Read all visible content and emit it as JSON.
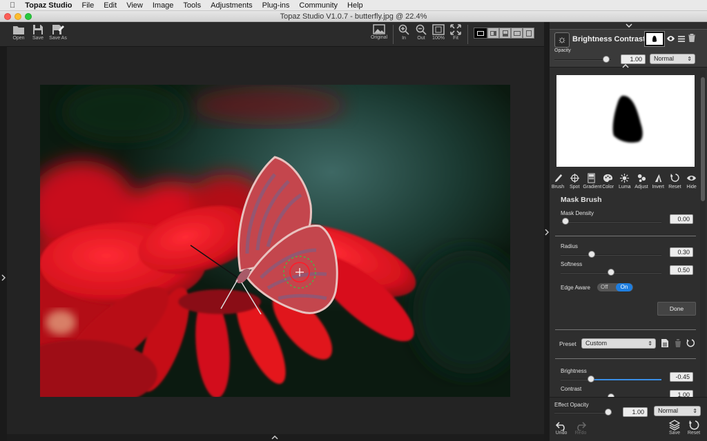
{
  "menubar": {
    "app": "Topaz Studio",
    "items": [
      "File",
      "Edit",
      "View",
      "Image",
      "Tools",
      "Adjustments",
      "Plug-ins",
      "Community",
      "Help"
    ]
  },
  "window": {
    "title": "Topaz Studio V1.0.7 - butterfly.jpg @ 22.4%"
  },
  "toolbar": {
    "open": "Open",
    "save": "Save",
    "save_as": "Save As",
    "original": "Original",
    "zoom_in": "In",
    "zoom_out": "Out",
    "zoom_100": "100%",
    "zoom_fit": "Fit"
  },
  "panel": {
    "header_title": "Brightness Contrast",
    "opacity_label": "Opacity",
    "opacity_value": "1.00",
    "opacity_level": 1.0,
    "blend_mode": "Normal",
    "mask_tools": [
      {
        "label": "Brush",
        "icon": "brush-icon"
      },
      {
        "label": "Spot",
        "icon": "spot-icon"
      },
      {
        "label": "Gradient",
        "icon": "gradient-icon"
      },
      {
        "label": "Color",
        "icon": "color-icon"
      },
      {
        "label": "Luma",
        "icon": "luma-icon"
      },
      {
        "label": "Adjust",
        "icon": "adjust-icon"
      },
      {
        "label": "Invert",
        "icon": "invert-icon"
      },
      {
        "label": "Reset",
        "icon": "reset-icon"
      },
      {
        "label": "Hide",
        "icon": "hide-icon"
      }
    ],
    "mask_brush_title": "Mask Brush",
    "mask_density_label": "Mask Density",
    "mask_density_value": "0.00",
    "radius_label": "Radius",
    "radius_value": "0.30",
    "softness_label": "Softness",
    "softness_value": "0.50",
    "edge_aware_label": "Edge Aware",
    "edge_off": "Off",
    "edge_on": "On",
    "done_label": "Done",
    "preset_label": "Preset",
    "preset_value": "Custom",
    "brightness_label": "Brightness",
    "brightness_value": "-0.45",
    "contrast_label": "Contrast",
    "contrast_value": "1.00",
    "effect_opacity_label": "Effect Opacity",
    "effect_opacity_value": "1.00",
    "effect_blend_mode": "Normal",
    "undo_label": "Undo",
    "redo_label": "Redo",
    "save_label": "Save",
    "reset_label": "Reset"
  }
}
